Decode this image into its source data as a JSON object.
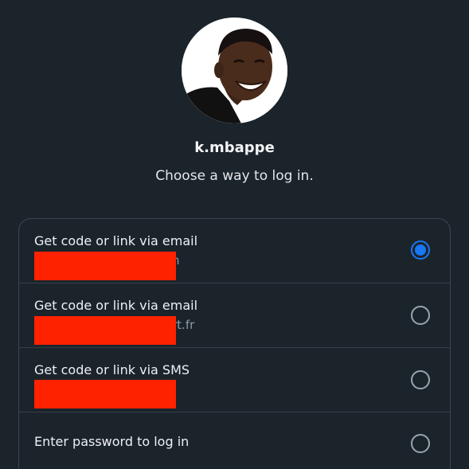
{
  "profile": {
    "username": "k.mbappe",
    "avatar_alt": "profile-photo"
  },
  "prompt": "Choose a way to log in.",
  "options": [
    {
      "label": "Get code or link via email",
      "detail_visible": "n",
      "selected": true
    },
    {
      "label": "Get code or link via email",
      "detail_visible": "rt.fr",
      "selected": false
    },
    {
      "label": "Get code or link via SMS",
      "detail_visible": "",
      "selected": false
    },
    {
      "label": "Enter password to log in",
      "selected": false
    }
  ],
  "colors": {
    "background": "#1c242b",
    "accent": "#1877f2",
    "redaction": "#ff2200"
  }
}
